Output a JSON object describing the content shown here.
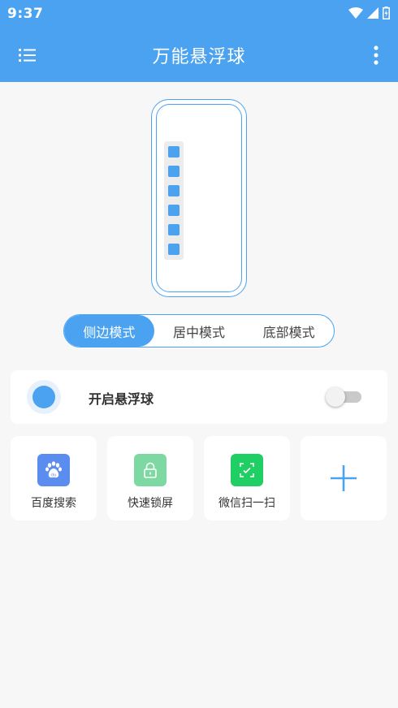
{
  "status_bar": {
    "time": "9:37"
  },
  "header": {
    "title": "万能悬浮球"
  },
  "colors": {
    "accent": "#4aa2f0",
    "baidu": "#5b8cf0",
    "lock": "#7dd9a1",
    "wechat": "#1fcf63"
  },
  "preview": {
    "side_dot_count": 6
  },
  "modes": {
    "items": [
      {
        "label": "侧边模式",
        "active": true
      },
      {
        "label": "居中模式",
        "active": false
      },
      {
        "label": "底部模式",
        "active": false
      }
    ]
  },
  "float_ball": {
    "label": "开启悬浮球",
    "enabled": false
  },
  "shortcuts": [
    {
      "label": "百度搜索",
      "icon": "baidu-paw-icon"
    },
    {
      "label": "快速锁屏",
      "icon": "lock-icon"
    },
    {
      "label": "微信扫一扫",
      "icon": "wechat-scan-icon"
    }
  ]
}
